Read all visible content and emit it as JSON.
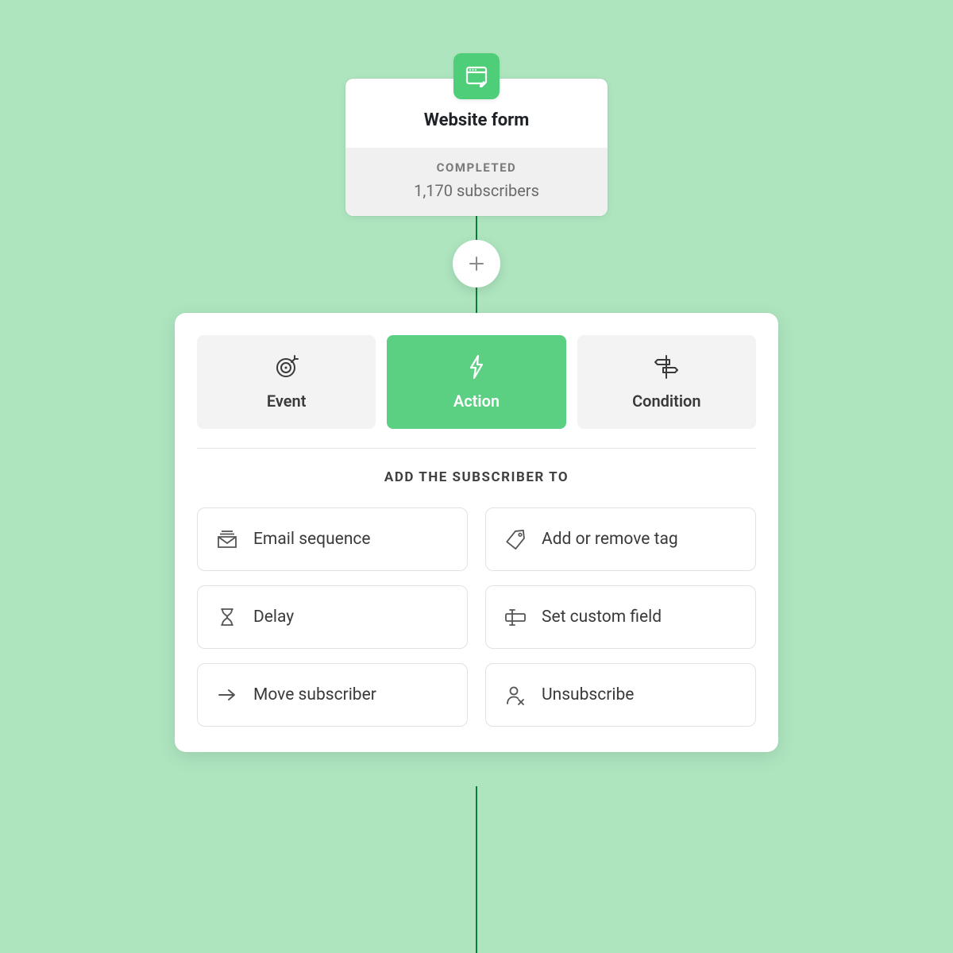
{
  "trigger": {
    "title": "Website form",
    "status_label": "COMPLETED",
    "subscribers_text": "1,170 subscribers"
  },
  "tabs": {
    "event": "Event",
    "action": "Action",
    "condition": "Condition"
  },
  "section_header": "ADD THE SUBSCRIBER TO",
  "options": {
    "email_sequence": "Email sequence",
    "add_remove_tag": "Add or remove tag",
    "delay": "Delay",
    "set_custom_field": "Set custom field",
    "move_subscriber": "Move subscriber",
    "unsubscribe": "Unsubscribe"
  }
}
